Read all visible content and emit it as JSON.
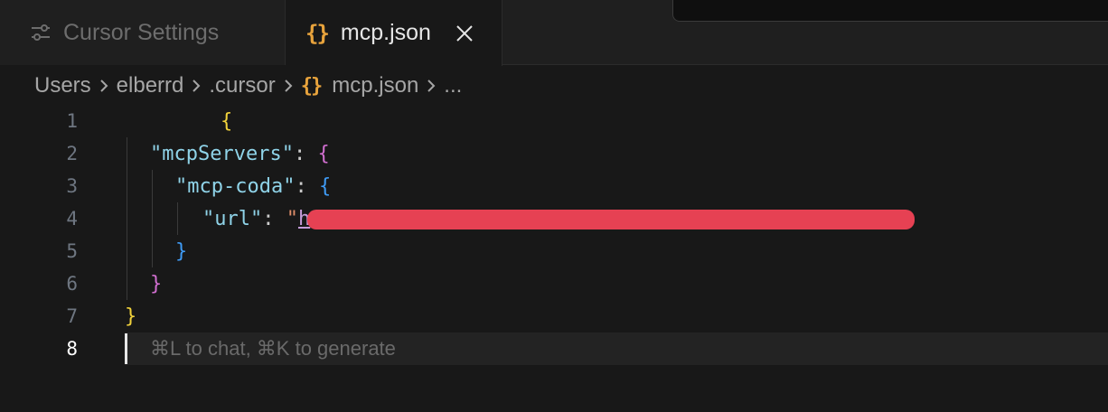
{
  "tabs": [
    {
      "label": "Cursor Settings",
      "icon": "sliders-icon",
      "active": false
    },
    {
      "label": "mcp.json",
      "icon": "{}",
      "active": true
    }
  ],
  "breadcrumb": {
    "items": [
      "Users",
      "elberrd",
      ".cursor",
      "mcp.json",
      "..."
    ],
    "json_icon": "{}"
  },
  "editor": {
    "line_numbers": [
      "1",
      "2",
      "3",
      "4",
      "5",
      "6",
      "7",
      "8"
    ],
    "current_line": 8,
    "lines": {
      "l1": {
        "brace": "{"
      },
      "l2": {
        "key": "\"mcpServers\"",
        "colon": ": ",
        "brace": "{"
      },
      "l3": {
        "key": "\"mcp-coda\"",
        "colon": ": ",
        "brace": "{"
      },
      "l4": {
        "key": "\"url\"",
        "colon": ": ",
        "value_open": "\"",
        "value_visible": "h",
        "value_close": "\""
      },
      "l5": {
        "brace": "}"
      },
      "l6": {
        "brace": "}"
      },
      "l7": {
        "brace": "}"
      }
    },
    "hint": "⌘L to chat, ⌘K to generate"
  },
  "colors": {
    "json_icon": "#e8a33c",
    "brace_level1": "#f1d23b",
    "brace_level2": "#d16fd0",
    "brace_level3": "#3f9bf5",
    "redaction": "#e64153"
  }
}
